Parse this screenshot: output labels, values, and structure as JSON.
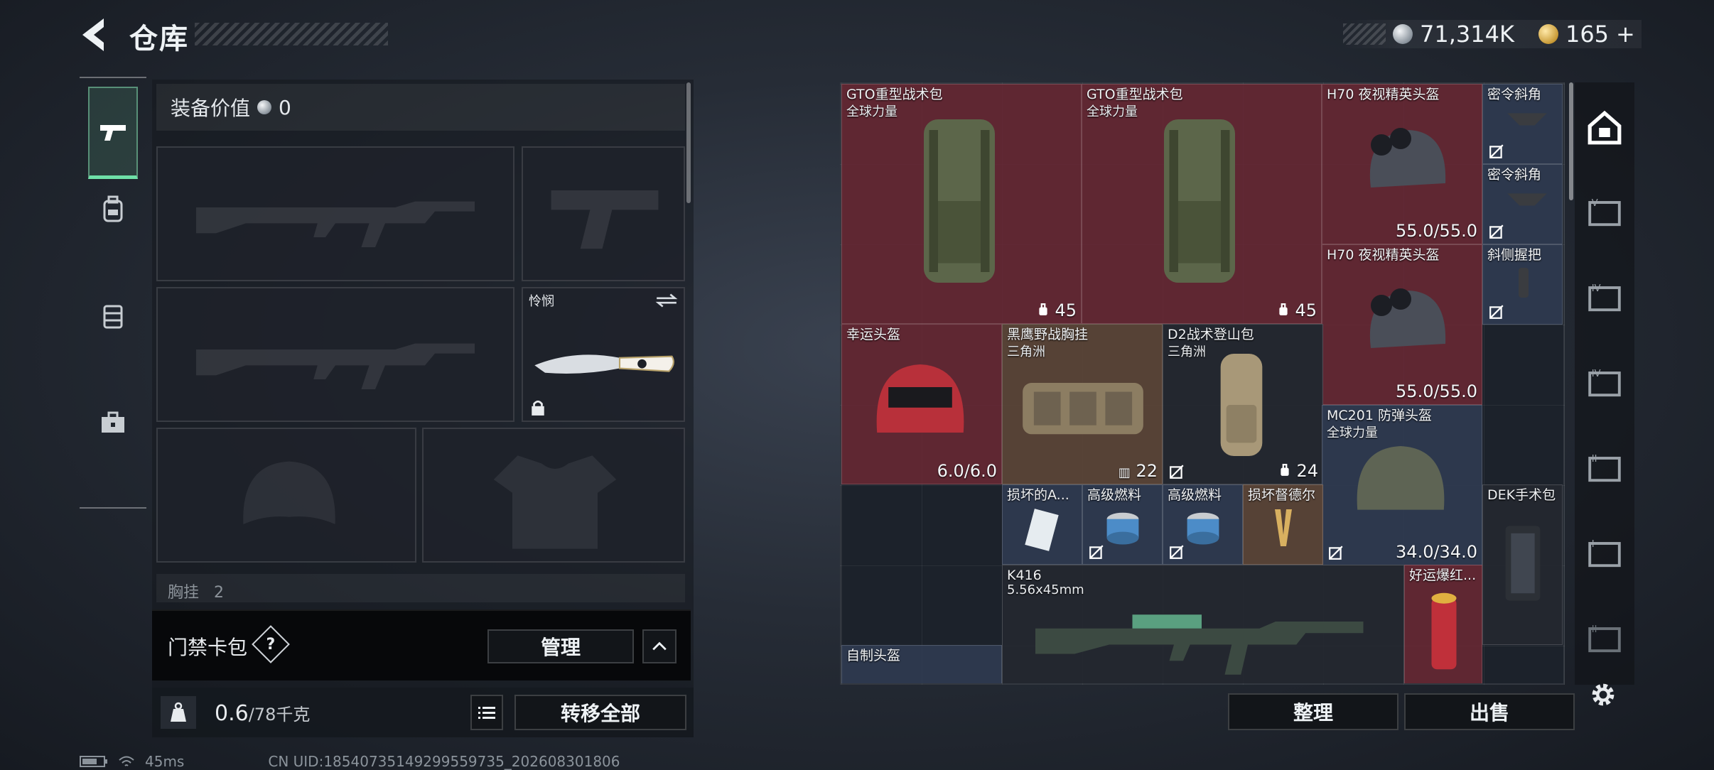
{
  "header": {
    "title": "仓库"
  },
  "currency": {
    "silver": "71,314K",
    "gold": "165",
    "gold_add": "+"
  },
  "left_panel": {
    "equip_value_label": "装备价值",
    "equip_value": "0",
    "melee_label": "怜悯",
    "chest_label": "胸挂",
    "chest_count": "2"
  },
  "keycard": {
    "label": "门禁卡包",
    "help": "?",
    "manage_button": "管理"
  },
  "weight": {
    "current": "0.6",
    "max": "/78千克",
    "transfer_all": "转移全部"
  },
  "stash_items": {
    "gto1": {
      "name": "GTO重型战术包",
      "sub": "全球力量",
      "value": "45"
    },
    "gto2": {
      "name": "GTO重型战术包",
      "sub": "全球力量",
      "value": "45"
    },
    "h70a": {
      "name": "H70 夜视精英头盔",
      "value": "55.0/55.0"
    },
    "h70b": {
      "name": "H70 夜视精英头盔",
      "value": "55.0/55.0"
    },
    "grip1": {
      "name": "密令斜角"
    },
    "grip2": {
      "name": "密令斜角"
    },
    "grip3": {
      "name": "斜侧握把"
    },
    "lucky_helmet": {
      "name": "幸运头盔",
      "value": "6.0/6.0"
    },
    "chest_rig": {
      "name": "黑鹰野战胸挂",
      "sub": "三角洲",
      "value": "22"
    },
    "d2_pack": {
      "name": "D2战术登山包",
      "sub": "三角洲",
      "value": "24"
    },
    "mc201": {
      "name": "MC201 防弹头盔",
      "sub": "全球力量",
      "value": "34.0/34.0"
    },
    "damaged_a": {
      "name": "损坏的A..."
    },
    "fuel1": {
      "name": "高级燃料"
    },
    "fuel2": {
      "name": "高级燃料"
    },
    "damaged_b": {
      "name": "损坏督德尔"
    },
    "dek": {
      "name": "DEK手术包"
    },
    "k416": {
      "name": "K416",
      "sub": "5.56x45mm"
    },
    "lucky_firework": {
      "name": "好运爆红..."
    },
    "diy_helmet": {
      "name": "自制头盔"
    }
  },
  "buttons": {
    "sort": "整理",
    "sell": "出售"
  },
  "status": {
    "ping": "45ms",
    "uid": "CN UID:18540735149299559735_202608301806"
  },
  "colors": {
    "red_cell": "#6e2834",
    "brown_cell": "#604838",
    "blue_cell": "#303c54",
    "accent_green": "#6fe0a8"
  },
  "icons": [
    "back-arrow-icon",
    "silver-coin-icon",
    "gold-coin-icon",
    "pistol-icon",
    "backpack-icon",
    "vest-icon",
    "toolbox-icon",
    "weight-icon",
    "list-icon",
    "chevron-up-icon",
    "safe-icon",
    "case-icon",
    "gear-icon",
    "wifi-icon",
    "battery-icon"
  ]
}
